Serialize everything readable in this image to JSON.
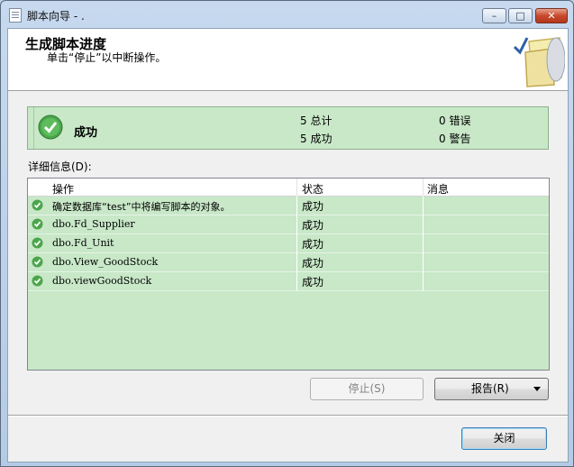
{
  "window": {
    "title": "脚本向导 - .",
    "minimize_glyph": "–",
    "maximize_glyph": "□",
    "close_glyph": "✕"
  },
  "header": {
    "title": "生成脚本进度",
    "subtitle": "单击“停止”以中断操作。"
  },
  "status": {
    "result": "成功",
    "total": "5 总计",
    "success": "5 成功",
    "errors": "0 错误",
    "warnings": "0 警告",
    "icon": "check-circle-icon"
  },
  "details": {
    "label": "详细信息(D):",
    "columns": [
      "操作",
      "状态",
      "消息"
    ],
    "rows": [
      {
        "op": "确定数据库“test”中将编写脚本的对象。",
        "status": "成功",
        "message": ""
      },
      {
        "op": "dbo.Fd_Supplier",
        "status": "成功",
        "message": ""
      },
      {
        "op": "dbo.Fd_Unit",
        "status": "成功",
        "message": ""
      },
      {
        "op": "dbo.View_GoodStock",
        "status": "成功",
        "message": ""
      },
      {
        "op": "dbo.viewGoodStock",
        "status": "成功",
        "message": ""
      }
    ]
  },
  "buttons": {
    "stop": "停止(S)",
    "report": "报告(R)",
    "close": "关闭"
  },
  "colors": {
    "success_bg": "#c8e8c8",
    "success_icon": "#4ca54c"
  }
}
